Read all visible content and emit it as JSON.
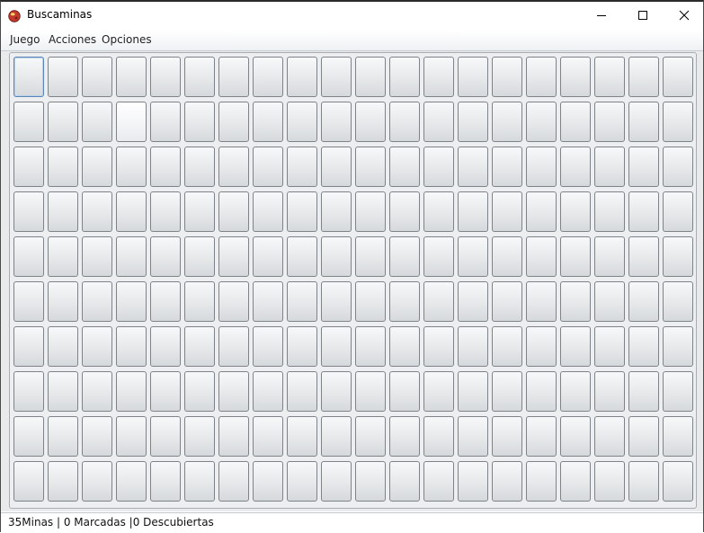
{
  "window": {
    "title": "Buscaminas",
    "icon": "minesweeper-app-icon",
    "controls": [
      "minimize-icon",
      "maximize-icon",
      "close-icon"
    ]
  },
  "menu": {
    "items": [
      {
        "label": "Juego"
      },
      {
        "label": "Acciones"
      },
      {
        "label": "Opciones"
      }
    ]
  },
  "board": {
    "rows": 10,
    "cols": 20,
    "focused_cell": [
      0,
      0
    ],
    "hovered_cell": [
      1,
      3
    ],
    "cell_state": "covered"
  },
  "status": {
    "text": "35Minas | 0 Marcadas |0 Descubiertas"
  },
  "colors": {
    "cell_border": "#7e8389",
    "focus_border": "#5b87b8",
    "board_background": "#e8eaec"
  }
}
